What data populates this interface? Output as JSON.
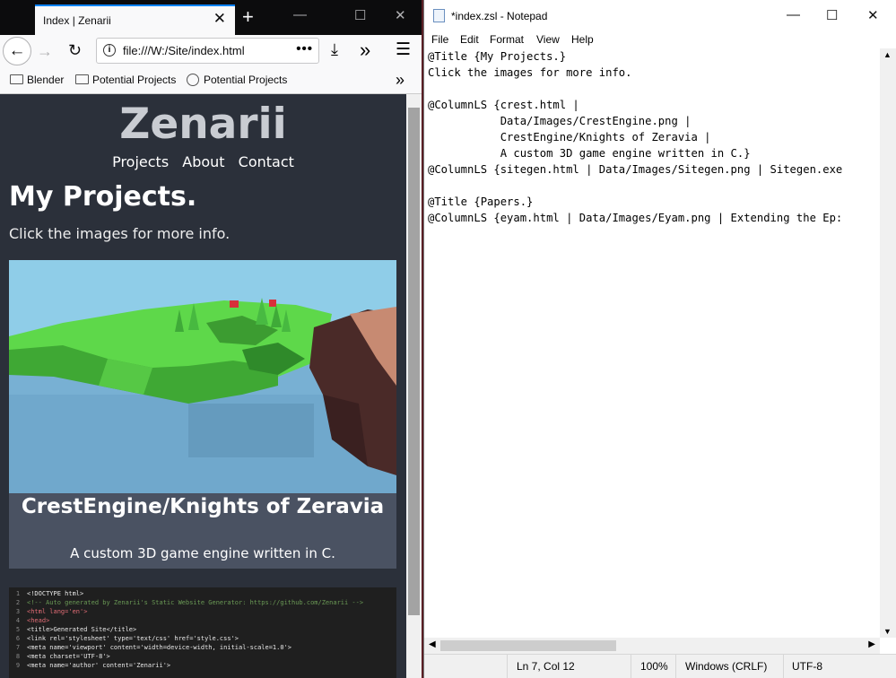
{
  "firefox": {
    "tab_title": "Index | Zenarii",
    "url": "file:///W:/Site/index.html",
    "bookmarks": [
      "Blender",
      "Potential Projects",
      "Potential Projects"
    ]
  },
  "site": {
    "title": "Zenarii",
    "nav": [
      "Projects",
      "About",
      "Contact"
    ],
    "heading": "My Projects.",
    "subheading": "Click the images for more info.",
    "project": {
      "title": "CrestEngine/Knights of Zeravia",
      "description": "A custom 3D game engine written in C."
    },
    "code_lines": [
      {
        "n": "1",
        "text": "<!DOCTYPE html>"
      },
      {
        "n": "2",
        "text": "<!-- Auto generated by Zenarii's Static Website Generator: https://github.com/Zenarii -->"
      },
      {
        "n": "3",
        "text": "<html lang='en'>"
      },
      {
        "n": "4",
        "text": "<head>"
      },
      {
        "n": "5",
        "text": "<title>Generated Site</title>"
      },
      {
        "n": "6",
        "text": "<link rel='stylesheet' type='text/css' href='style.css'>"
      },
      {
        "n": "7",
        "text": "<meta name='viewport' content='width=device-width, initial-scale=1.0'>"
      },
      {
        "n": "8",
        "text": "<meta charset='UTF-8'>"
      },
      {
        "n": "9",
        "text": "<meta name='author' content='Zenarii'>"
      }
    ]
  },
  "notepad": {
    "title": "*index.zsl - Notepad",
    "menu": [
      "File",
      "Edit",
      "Format",
      "View",
      "Help"
    ],
    "lines": [
      "@Title {My Projects.}",
      "Click the images for more info.",
      "",
      "@ColumnLS {crest.html |",
      "           Data/Images/CrestEngine.png |",
      "           CrestEngine/Knights of Zeravia |",
      "           A custom 3D game engine written in C.}",
      "@ColumnLS {sitegen.html | Data/Images/Sitegen.png | Sitegen.exe",
      "",
      "@Title {Papers.}",
      "@ColumnLS {eyam.html | Data/Images/Eyam.png | Extending the Ep:"
    ],
    "status": {
      "position": "Ln 7, Col 12",
      "zoom": "100%",
      "line_ending": "Windows (CRLF)",
      "encoding": "UTF-8"
    }
  },
  "colors": {
    "site_bg": "#2b303a",
    "card_bg": "#4a5262",
    "tab_accent": "#0a84ff"
  }
}
